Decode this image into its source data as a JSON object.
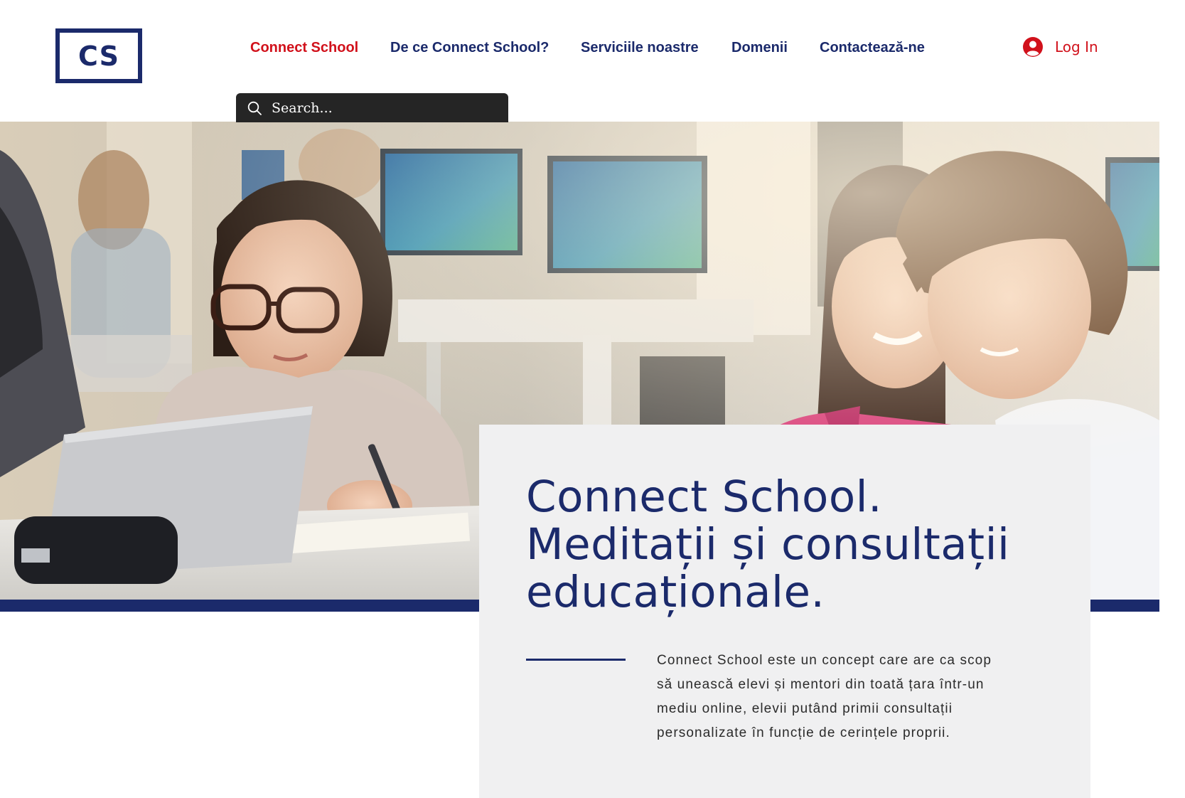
{
  "brand": {
    "logo_text": "CS"
  },
  "nav": {
    "items": [
      {
        "label": "Connect School",
        "active": true
      },
      {
        "label": "De ce Connect School?",
        "active": false
      },
      {
        "label": "Serviciile noastre",
        "active": false
      },
      {
        "label": "Domenii",
        "active": false
      },
      {
        "label": "Contactează-ne",
        "active": false
      }
    ]
  },
  "login": {
    "label": "Log In",
    "icon": "user-avatar-icon"
  },
  "search": {
    "placeholder": "Search...",
    "icon": "search-icon"
  },
  "hero": {
    "image": "students-in-computer-classroom-photo",
    "title_lines": [
      "Connect School.",
      "Meditații și consultații",
      "educaționale."
    ],
    "description_lines": [
      "Connect School este un concept care are ca scop",
      "să unească elevi și mentori din toată țara într-un",
      "mediu online, elevii putând primii consultații",
      "personalizate în funcție de cerințele proprii."
    ]
  },
  "colors": {
    "brand_navy": "#1b2a6b",
    "accent_red": "#d1111b",
    "card_bg": "#f0f0f1",
    "search_bg": "#252525"
  }
}
